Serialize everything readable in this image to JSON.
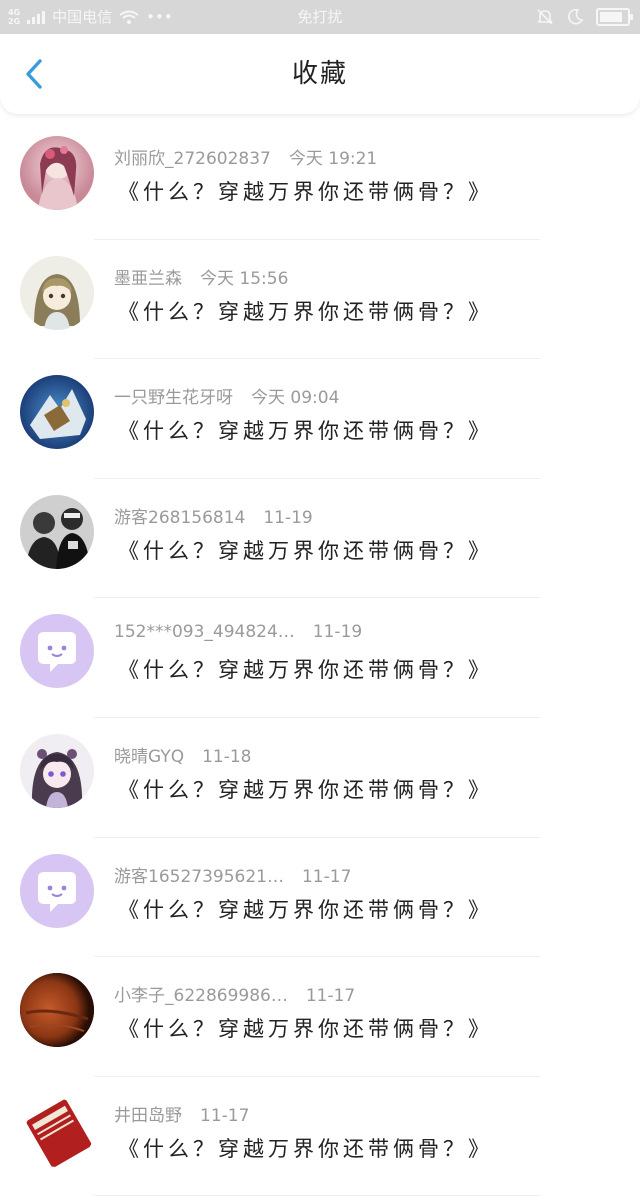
{
  "status_bar": {
    "net_top": "4G",
    "net_bottom": "2G",
    "carrier": "中国电信",
    "dots": "•••",
    "center_text": "免打扰",
    "icons": [
      "signal-icon",
      "wifi-icon",
      "bell-off-icon",
      "moon-icon",
      "battery-icon"
    ],
    "battery_level": 0.9
  },
  "header": {
    "title": "收藏",
    "back_icon": "chevron-left-icon",
    "accent_color": "#3a9bdc"
  },
  "items": [
    {
      "name": "刘丽欣_272602837",
      "time": "今天 19:21",
      "quote": "《什么？穿越万界你还带俩骨？》",
      "avatar": "pink-portrait"
    },
    {
      "name": "墨亜兰森",
      "time": "今天 15:56",
      "quote": "《什么？穿越万界你还带俩骨？》",
      "avatar": "anime-girl"
    },
    {
      "name": "一只野生花牙呀",
      "time": "今天 09:04",
      "quote": "《什么？穿越万界你还带俩骨？》",
      "avatar": "blue-art"
    },
    {
      "name": "游客268156814",
      "time": "11-19",
      "quote": "《什么？穿越万界你还带俩骨？》",
      "avatar": "group-photo"
    },
    {
      "name": "152***093_494824…",
      "time": "11-19",
      "quote": "《什么？穿越万界你还带俩骨？》",
      "avatar": "default-chat"
    },
    {
      "name": "晓晴GYQ",
      "time": "11-18",
      "quote": "《什么？穿越万界你还带俩骨？》",
      "avatar": "anime-purple"
    },
    {
      "name": "游客16527395621…",
      "time": "11-17",
      "quote": "《什么？穿越万界你还带俩骨？》",
      "avatar": "default-chat"
    },
    {
      "name": "小李子_622869986…",
      "time": "11-17",
      "quote": "《什么？穿越万界你还带俩骨？》",
      "avatar": "mars"
    },
    {
      "name": "井田岛野",
      "time": "11-17",
      "quote": "《什么？穿越万界你还带俩骨？》",
      "avatar": "red-book"
    }
  ]
}
